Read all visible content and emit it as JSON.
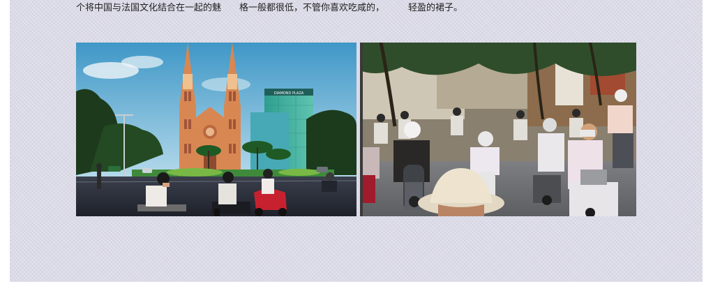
{
  "article": {
    "caption_segments": [
      "个将中国与法国文化结合在一起的魅",
      "格一般都很低，不管你喜欢吃咸的，",
      "轻盈的裙子。"
    ],
    "photos": [
      {
        "subject": "cathedral-street-photo",
        "sign_text": "DIAMOND PLAZA"
      },
      {
        "subject": "motorbike-traffic-photo"
      }
    ]
  },
  "colors": {
    "page_background": "#ffffff",
    "panel_background": "#dcdbe9",
    "caption_text": "#222222"
  }
}
